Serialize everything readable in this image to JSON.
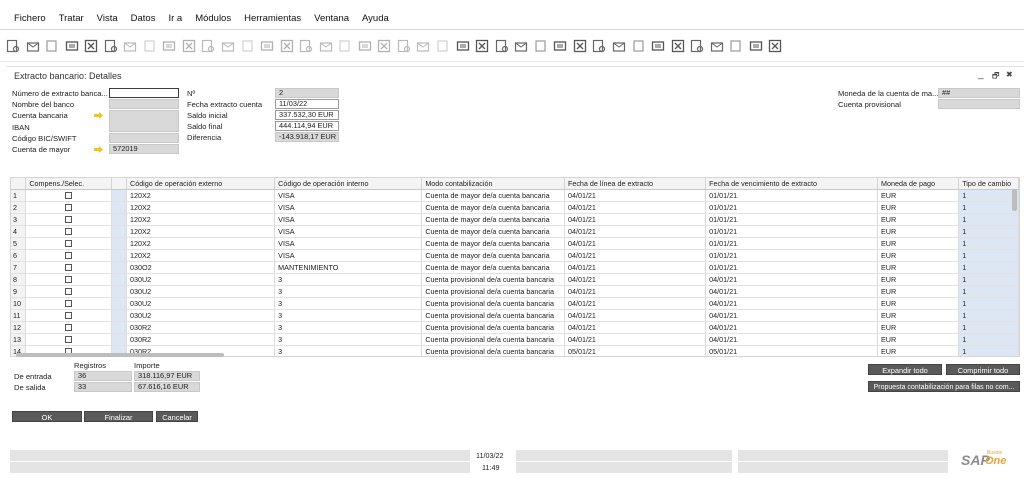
{
  "menu": [
    "Fichero",
    "Tratar",
    "Vista",
    "Datos",
    "Ir a",
    "Módulos",
    "Herramientas",
    "Ventana",
    "Ayuda"
  ],
  "toolbar_icons": [
    "preview-icon",
    "print-icon",
    "send-email-icon",
    "export-word-icon",
    "export-excel-icon",
    "pdf-icon",
    "word-icon",
    "move-icon",
    "filter-icon",
    "find-icon",
    "add-icon",
    "first-record-icon",
    "previous-record-icon",
    "next-record-icon",
    "last-record-icon",
    "refresh-icon",
    "filter-table-icon",
    "sort-icon",
    "layout-icon",
    "form-settings-icon",
    "lock-icon",
    "chart-icon",
    "gross-profit-icon",
    "base-document-icon",
    "target-document-icon",
    "journal-icon",
    "settings-icon",
    "message-icon",
    "message-ext-icon",
    "alert-icon",
    "calendar-icon",
    "calculator-icon",
    "structure-icon",
    "user-icon",
    "cockpit-icon",
    "dashboard-icon",
    "report-icon",
    "drag-icon",
    "portal-icon",
    "help-icon"
  ],
  "window": {
    "title": "Extracto bancario: Detalles",
    "controls": [
      "_",
      "🗗",
      "✖"
    ]
  },
  "header": {
    "labels": {
      "statement_number": "Número de extracto banca...",
      "bank_name": "Nombre del banco",
      "bank_account": "Cuenta bancaria",
      "iban": "IBAN",
      "bic": "Código BIC/SWIFT",
      "gl_account": "Cuenta de mayor",
      "no": "Nº",
      "statement_date": "Fecha extracto cuenta",
      "opening_balance": "Saldo inicial",
      "ending_balance": "Saldo final",
      "difference": "Diferencia",
      "account_currency": "Moneda de la cuenta de ma...",
      "provisional_account": "Cuenta provisional"
    },
    "values": {
      "statement_number": "",
      "gl_account": "572019",
      "no": "2",
      "statement_date": "11/03/22",
      "opening_balance": "337.532,30 EUR",
      "ending_balance": "444.114,94 EUR",
      "difference": "-143.918,17 EUR",
      "account_currency": "##",
      "provisional_account": ""
    }
  },
  "grid": {
    "columns": [
      "",
      "Compens./Selec.",
      "",
      "Código de operación externo",
      "Código de operación interno",
      "Modo contabilización",
      "Fecha de línea de extracto",
      "Fecha de vencimiento de extracto",
      "Moneda de pago",
      "Tipo de cambio"
    ],
    "rows": [
      {
        "n": "1",
        "ext": "120X2",
        "int": "VISA",
        "mode": "Cuenta de mayor de/a cuenta bancaria",
        "date": "04/01/21",
        "due": "01/01/21",
        "cur": "EUR",
        "rate": "1"
      },
      {
        "n": "2",
        "ext": "120X2",
        "int": "VISA",
        "mode": "Cuenta de mayor de/a cuenta bancaria",
        "date": "04/01/21",
        "due": "01/01/21",
        "cur": "EUR",
        "rate": "1"
      },
      {
        "n": "3",
        "ext": "120X2",
        "int": "VISA",
        "mode": "Cuenta de mayor de/a cuenta bancaria",
        "date": "04/01/21",
        "due": "01/01/21",
        "cur": "EUR",
        "rate": "1"
      },
      {
        "n": "4",
        "ext": "120X2",
        "int": "VISA",
        "mode": "Cuenta de mayor de/a cuenta bancaria",
        "date": "04/01/21",
        "due": "01/01/21",
        "cur": "EUR",
        "rate": "1"
      },
      {
        "n": "5",
        "ext": "120X2",
        "int": "VISA",
        "mode": "Cuenta de mayor de/a cuenta bancaria",
        "date": "04/01/21",
        "due": "01/01/21",
        "cur": "EUR",
        "rate": "1"
      },
      {
        "n": "6",
        "ext": "120X2",
        "int": "VISA",
        "mode": "Cuenta de mayor de/a cuenta bancaria",
        "date": "04/01/21",
        "due": "01/01/21",
        "cur": "EUR",
        "rate": "1"
      },
      {
        "n": "7",
        "ext": "030O2",
        "int": "MANTENIMIENTO",
        "mode": "Cuenta de mayor de/a cuenta bancaria",
        "date": "04/01/21",
        "due": "01/01/21",
        "cur": "EUR",
        "rate": "1"
      },
      {
        "n": "8",
        "ext": "030U2",
        "int": "3",
        "mode": "Cuenta provisional de/a cuenta bancaria",
        "date": "04/01/21",
        "due": "04/01/21",
        "cur": "EUR",
        "rate": "1"
      },
      {
        "n": "9",
        "ext": "030U2",
        "int": "3",
        "mode": "Cuenta provisional de/a cuenta bancaria",
        "date": "04/01/21",
        "due": "04/01/21",
        "cur": "EUR",
        "rate": "1"
      },
      {
        "n": "10",
        "ext": "030U2",
        "int": "3",
        "mode": "Cuenta provisional de/a cuenta bancaria",
        "date": "04/01/21",
        "due": "04/01/21",
        "cur": "EUR",
        "rate": "1"
      },
      {
        "n": "11",
        "ext": "030U2",
        "int": "3",
        "mode": "Cuenta provisional de/a cuenta bancaria",
        "date": "04/01/21",
        "due": "04/01/21",
        "cur": "EUR",
        "rate": "1"
      },
      {
        "n": "12",
        "ext": "030R2",
        "int": "3",
        "mode": "Cuenta provisional de/a cuenta bancaria",
        "date": "04/01/21",
        "due": "04/01/21",
        "cur": "EUR",
        "rate": "1"
      },
      {
        "n": "13",
        "ext": "030R2",
        "int": "3",
        "mode": "Cuenta provisional de/a cuenta bancaria",
        "date": "04/01/21",
        "due": "04/01/21",
        "cur": "EUR",
        "rate": "1"
      },
      {
        "n": "14",
        "ext": "030R2",
        "int": "3",
        "mode": "Cuenta provisional de/a cuenta bancaria",
        "date": "05/01/21",
        "due": "05/01/21",
        "cur": "EUR",
        "rate": "1"
      }
    ]
  },
  "summary": {
    "col_records": "Registros",
    "col_amount": "Importe",
    "incoming_label": "De entrada",
    "incoming_records": "36",
    "incoming_amount": "318.116,97 EUR",
    "outgoing_label": "De salida",
    "outgoing_records": "33",
    "outgoing_amount": "67.616,16 EUR"
  },
  "buttons": {
    "expand_all": "Expandir todo",
    "collapse_all": "Comprimir todo",
    "proposal": "Propuesta contabilización para filas no com...",
    "ok": "OK",
    "finish": "Finalizar",
    "cancel": "Cancelar"
  },
  "status": {
    "date": "11/03/22",
    "time": "11:49"
  },
  "logo": {
    "sap": "SAP",
    "business": "Busine",
    "one": "One"
  },
  "colors": {
    "button": "#5a5a5a",
    "selected_column": "#dde7f4",
    "arrow": "#f0c419",
    "logo_orange": "#e8a33a"
  }
}
